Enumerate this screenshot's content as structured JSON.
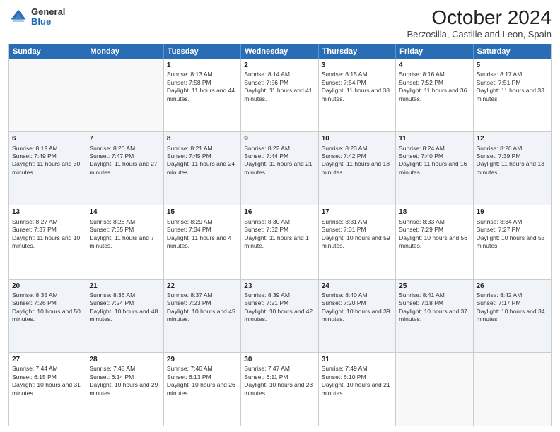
{
  "header": {
    "logo_general": "General",
    "logo_blue": "Blue",
    "month": "October 2024",
    "location": "Berzosilla, Castille and Leon, Spain"
  },
  "days_of_week": [
    "Sunday",
    "Monday",
    "Tuesday",
    "Wednesday",
    "Thursday",
    "Friday",
    "Saturday"
  ],
  "weeks": [
    [
      {
        "day": "",
        "empty": true
      },
      {
        "day": "",
        "empty": true
      },
      {
        "day": "1",
        "sunrise": "Sunrise: 8:13 AM",
        "sunset": "Sunset: 7:58 PM",
        "daylight": "Daylight: 11 hours and 44 minutes."
      },
      {
        "day": "2",
        "sunrise": "Sunrise: 8:14 AM",
        "sunset": "Sunset: 7:56 PM",
        "daylight": "Daylight: 11 hours and 41 minutes."
      },
      {
        "day": "3",
        "sunrise": "Sunrise: 8:15 AM",
        "sunset": "Sunset: 7:54 PM",
        "daylight": "Daylight: 11 hours and 38 minutes."
      },
      {
        "day": "4",
        "sunrise": "Sunrise: 8:16 AM",
        "sunset": "Sunset: 7:52 PM",
        "daylight": "Daylight: 11 hours and 36 minutes."
      },
      {
        "day": "5",
        "sunrise": "Sunrise: 8:17 AM",
        "sunset": "Sunset: 7:51 PM",
        "daylight": "Daylight: 11 hours and 33 minutes."
      }
    ],
    [
      {
        "day": "6",
        "sunrise": "Sunrise: 8:19 AM",
        "sunset": "Sunset: 7:49 PM",
        "daylight": "Daylight: 11 hours and 30 minutes."
      },
      {
        "day": "7",
        "sunrise": "Sunrise: 8:20 AM",
        "sunset": "Sunset: 7:47 PM",
        "daylight": "Daylight: 11 hours and 27 minutes."
      },
      {
        "day": "8",
        "sunrise": "Sunrise: 8:21 AM",
        "sunset": "Sunset: 7:45 PM",
        "daylight": "Daylight: 11 hours and 24 minutes."
      },
      {
        "day": "9",
        "sunrise": "Sunrise: 8:22 AM",
        "sunset": "Sunset: 7:44 PM",
        "daylight": "Daylight: 11 hours and 21 minutes."
      },
      {
        "day": "10",
        "sunrise": "Sunrise: 8:23 AM",
        "sunset": "Sunset: 7:42 PM",
        "daylight": "Daylight: 11 hours and 18 minutes."
      },
      {
        "day": "11",
        "sunrise": "Sunrise: 8:24 AM",
        "sunset": "Sunset: 7:40 PM",
        "daylight": "Daylight: 11 hours and 16 minutes."
      },
      {
        "day": "12",
        "sunrise": "Sunrise: 8:26 AM",
        "sunset": "Sunset: 7:39 PM",
        "daylight": "Daylight: 11 hours and 13 minutes."
      }
    ],
    [
      {
        "day": "13",
        "sunrise": "Sunrise: 8:27 AM",
        "sunset": "Sunset: 7:37 PM",
        "daylight": "Daylight: 11 hours and 10 minutes."
      },
      {
        "day": "14",
        "sunrise": "Sunrise: 8:28 AM",
        "sunset": "Sunset: 7:35 PM",
        "daylight": "Daylight: 11 hours and 7 minutes."
      },
      {
        "day": "15",
        "sunrise": "Sunrise: 8:29 AM",
        "sunset": "Sunset: 7:34 PM",
        "daylight": "Daylight: 11 hours and 4 minutes."
      },
      {
        "day": "16",
        "sunrise": "Sunrise: 8:30 AM",
        "sunset": "Sunset: 7:32 PM",
        "daylight": "Daylight: 11 hours and 1 minute."
      },
      {
        "day": "17",
        "sunrise": "Sunrise: 8:31 AM",
        "sunset": "Sunset: 7:31 PM",
        "daylight": "Daylight: 10 hours and 59 minutes."
      },
      {
        "day": "18",
        "sunrise": "Sunrise: 8:33 AM",
        "sunset": "Sunset: 7:29 PM",
        "daylight": "Daylight: 10 hours and 56 minutes."
      },
      {
        "day": "19",
        "sunrise": "Sunrise: 8:34 AM",
        "sunset": "Sunset: 7:27 PM",
        "daylight": "Daylight: 10 hours and 53 minutes."
      }
    ],
    [
      {
        "day": "20",
        "sunrise": "Sunrise: 8:35 AM",
        "sunset": "Sunset: 7:26 PM",
        "daylight": "Daylight: 10 hours and 50 minutes."
      },
      {
        "day": "21",
        "sunrise": "Sunrise: 8:36 AM",
        "sunset": "Sunset: 7:24 PM",
        "daylight": "Daylight: 10 hours and 48 minutes."
      },
      {
        "day": "22",
        "sunrise": "Sunrise: 8:37 AM",
        "sunset": "Sunset: 7:23 PM",
        "daylight": "Daylight: 10 hours and 45 minutes."
      },
      {
        "day": "23",
        "sunrise": "Sunrise: 8:39 AM",
        "sunset": "Sunset: 7:21 PM",
        "daylight": "Daylight: 10 hours and 42 minutes."
      },
      {
        "day": "24",
        "sunrise": "Sunrise: 8:40 AM",
        "sunset": "Sunset: 7:20 PM",
        "daylight": "Daylight: 10 hours and 39 minutes."
      },
      {
        "day": "25",
        "sunrise": "Sunrise: 8:41 AM",
        "sunset": "Sunset: 7:18 PM",
        "daylight": "Daylight: 10 hours and 37 minutes."
      },
      {
        "day": "26",
        "sunrise": "Sunrise: 8:42 AM",
        "sunset": "Sunset: 7:17 PM",
        "daylight": "Daylight: 10 hours and 34 minutes."
      }
    ],
    [
      {
        "day": "27",
        "sunrise": "Sunrise: 7:44 AM",
        "sunset": "Sunset: 6:15 PM",
        "daylight": "Daylight: 10 hours and 31 minutes."
      },
      {
        "day": "28",
        "sunrise": "Sunrise: 7:45 AM",
        "sunset": "Sunset: 6:14 PM",
        "daylight": "Daylight: 10 hours and 29 minutes."
      },
      {
        "day": "29",
        "sunrise": "Sunrise: 7:46 AM",
        "sunset": "Sunset: 6:13 PM",
        "daylight": "Daylight: 10 hours and 26 minutes."
      },
      {
        "day": "30",
        "sunrise": "Sunrise: 7:47 AM",
        "sunset": "Sunset: 6:11 PM",
        "daylight": "Daylight: 10 hours and 23 minutes."
      },
      {
        "day": "31",
        "sunrise": "Sunrise: 7:49 AM",
        "sunset": "Sunset: 6:10 PM",
        "daylight": "Daylight: 10 hours and 21 minutes."
      },
      {
        "day": "",
        "empty": true
      },
      {
        "day": "",
        "empty": true
      }
    ]
  ]
}
